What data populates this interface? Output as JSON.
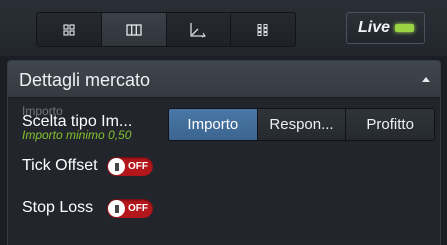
{
  "toolbar": {
    "views": [
      {
        "icon": "grid-2x2-icon",
        "active": false
      },
      {
        "icon": "columns-icon",
        "active": true
      },
      {
        "icon": "chart-axes-icon",
        "active": false
      },
      {
        "icon": "grid-3x3-icon",
        "active": false
      }
    ],
    "live_label": "Live",
    "live_led_color": "#9bd443"
  },
  "panel": {
    "title": "Dettagli mercato",
    "ghost_label": "Importo",
    "choose_type_label": "Scelta tipo Im...",
    "hint": "Importo minimo 0,50",
    "options": [
      "Importo",
      "Respon...",
      "Profitto"
    ],
    "selected_option": "Importo",
    "tick_offset": {
      "label": "Tick Offset",
      "state": "OFF"
    },
    "stop_loss": {
      "label": "Stop Loss",
      "state": "OFF"
    }
  },
  "colors": {
    "accent_blue": "#4a77a6",
    "toggle_off": "#b3171c",
    "hint_green": "#84c22f"
  }
}
